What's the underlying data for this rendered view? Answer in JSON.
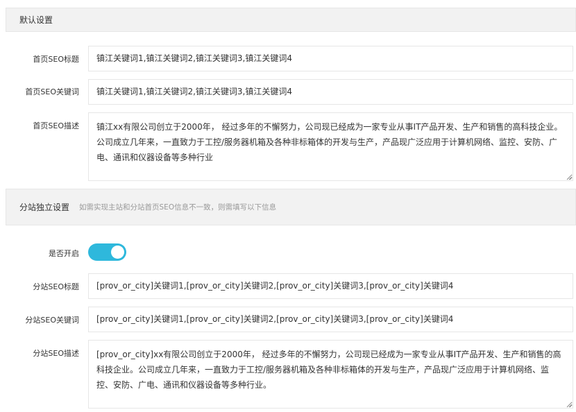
{
  "default_section": {
    "title": "默认设置",
    "home_seo_title": {
      "label": "首页SEO标题",
      "value": "镇江关键词1,镇江关键词2,镇江关键词3,镇江关键词4"
    },
    "home_seo_keywords": {
      "label": "首页SEO关键词",
      "value": "镇江关键词1,镇江关键词2,镇江关键词3,镇江关键词4"
    },
    "home_seo_description": {
      "label": "首页SEO描述",
      "value": "镇江xx有限公司创立于2000年， 经过多年的不懈努力，公司现已经成为一家专业从事IT产品开发、生产和销售的高科技企业。公司成立几年来，一直致力于工控/服务器机箱及各种非标箱体的开发与生产，产品现广泛应用于计算机网络、监控、安防、广电、通讯和仪器设备等多种行业"
    }
  },
  "substation_section": {
    "title": "分站独立设置",
    "note": "如需实现主站和分站首页SEO信息不一致，则需填写以下信息",
    "enabled": {
      "label": "是否开启",
      "value": true,
      "color": "#2eb8dc"
    },
    "sub_seo_title": {
      "label": "分站SEO标题",
      "value": "[prov_or_city]关键词1,[prov_or_city]关键词2,[prov_or_city]关键词3,[prov_or_city]关键词4"
    },
    "sub_seo_keywords": {
      "label": "分站SEO关键词",
      "value": "[prov_or_city]关键词1,[prov_or_city]关键词2,[prov_or_city]关键词3,[prov_or_city]关键词4"
    },
    "sub_seo_description": {
      "label": "分站SEO描述",
      "value": "[prov_or_city]xx有限公司创立于2000年， 经过多年的不懈努力，公司现已经成为一家专业从事IT产品开发、生产和销售的高科技企业。公司成立几年来，一直致力于工控/服务器机箱及各种非标箱体的开发与生产，产品现广泛应用于计算机网络、监控、安防、广电、通讯和仪器设备等多种行业。"
    }
  }
}
